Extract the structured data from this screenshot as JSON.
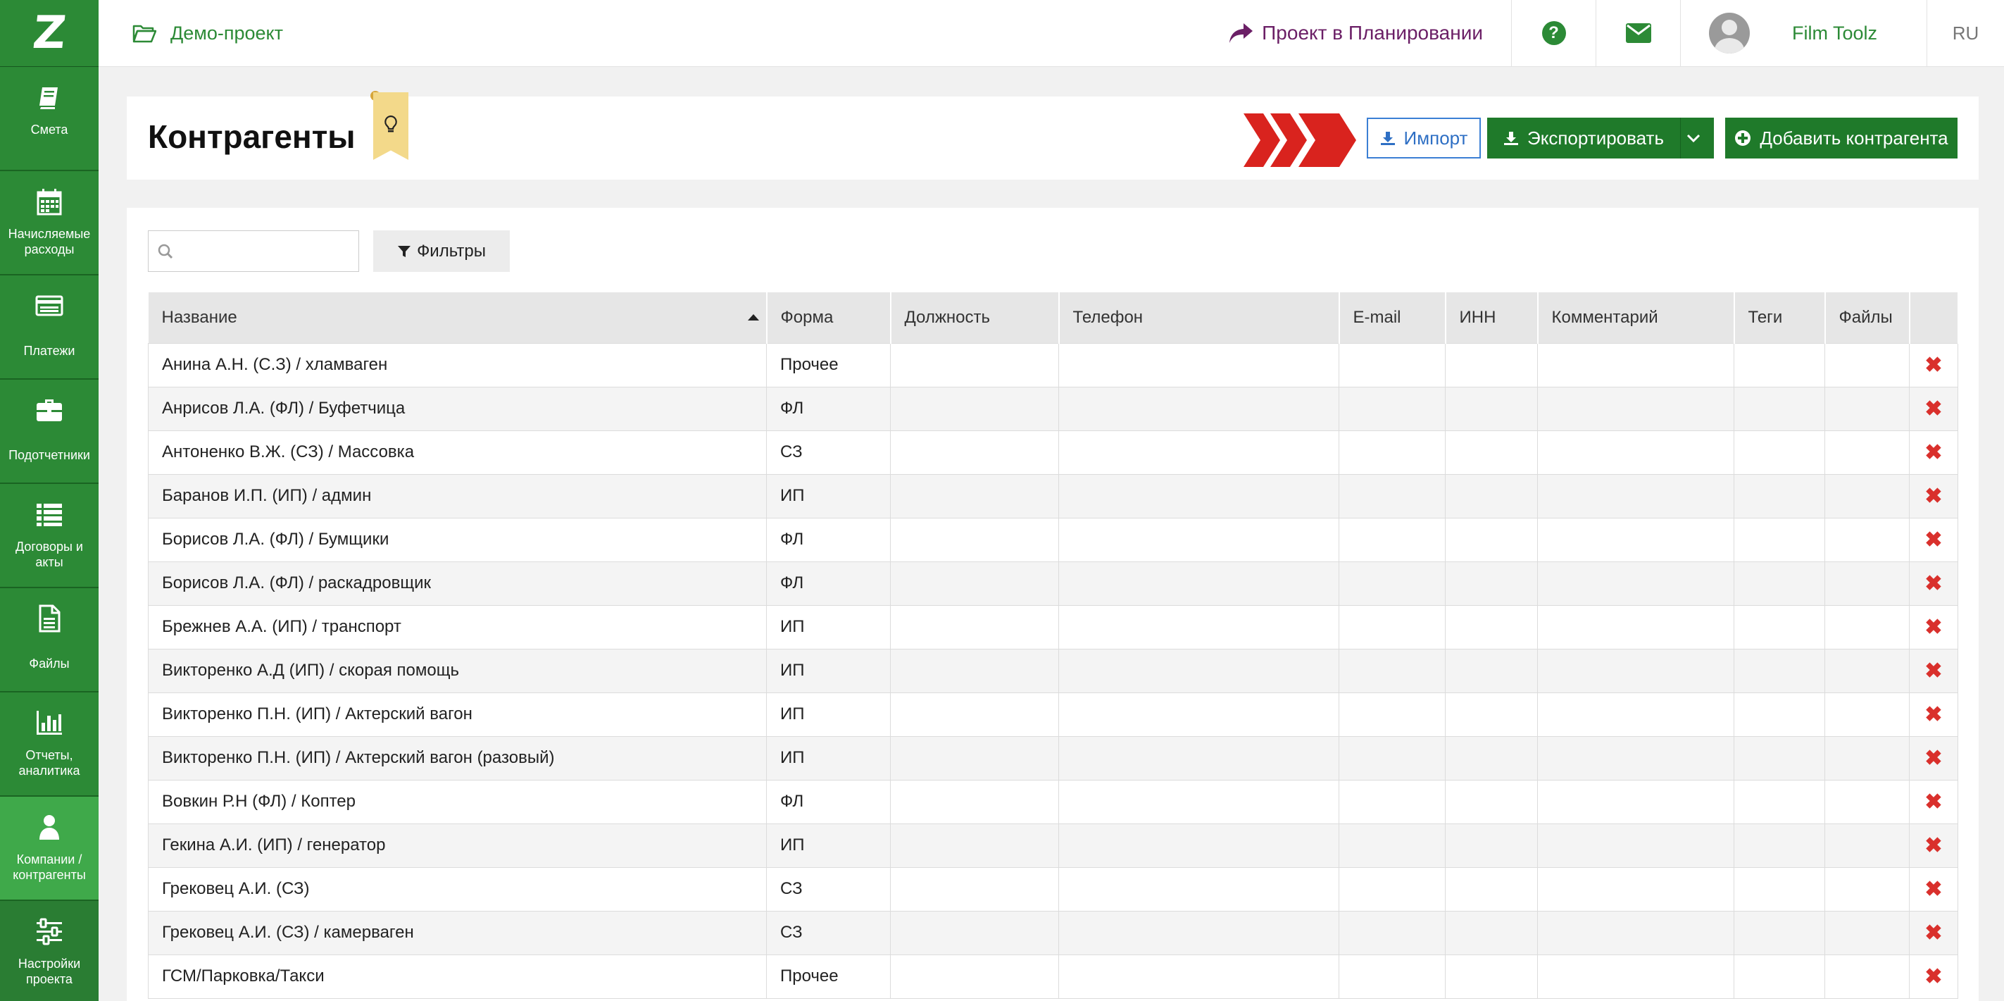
{
  "sidebar": {
    "logo": "Z",
    "items": [
      {
        "label": "Смета",
        "icon": "book-icon"
      },
      {
        "label": "Начисляемые расходы",
        "icon": "calendar-icon"
      },
      {
        "label": "Платежи",
        "icon": "card-icon"
      },
      {
        "label": "Подотчетники",
        "icon": "briefcase-icon"
      },
      {
        "label": "Договоры и акты",
        "icon": "list-icon"
      },
      {
        "label": "Файлы",
        "icon": "file-icon"
      },
      {
        "label": "Отчеты, аналитика",
        "icon": "bar-chart-icon"
      },
      {
        "label": "Компании / контрагенты",
        "icon": "user-icon"
      },
      {
        "label": "Настройки проекта",
        "icon": "sliders-icon"
      }
    ]
  },
  "topbar": {
    "project": "Демо-проект",
    "status": "Проект в Планировании",
    "user": "Film Toolz",
    "lang": "RU"
  },
  "header": {
    "title": "Контрагенты",
    "import_label": "Импорт",
    "export_label": "Экспортировать",
    "add_label": "Добавить контрагента"
  },
  "toolbar": {
    "search_placeholder": "",
    "filters_label": "Фильтры"
  },
  "table": {
    "columns": [
      "Название",
      "Форма",
      "Должность",
      "Телефон",
      "E-mail",
      "ИНН",
      "Комментарий",
      "Теги",
      "Файлы",
      ""
    ],
    "rows": [
      {
        "name": "Анина А.Н. (С.З) / хламваген",
        "form": "Прочее"
      },
      {
        "name": "Анрисов Л.А. (ФЛ) / Буфетчица",
        "form": "ФЛ"
      },
      {
        "name": "Антоненко В.Ж. (СЗ) / Массовка",
        "form": "СЗ"
      },
      {
        "name": "Баранов И.П. (ИП) / админ",
        "form": "ИП"
      },
      {
        "name": "Борисов Л.А. (ФЛ) / Бумщики",
        "form": "ФЛ"
      },
      {
        "name": "Борисов Л.А. (ФЛ) / раскадровщик",
        "form": "ФЛ"
      },
      {
        "name": "Брежнев А.А. (ИП) / транспорт",
        "form": "ИП"
      },
      {
        "name": "Викторенко А.Д (ИП) / скорая помощь",
        "form": "ИП"
      },
      {
        "name": "Викторенко П.Н. (ИП) / Актерский вагон",
        "form": "ИП"
      },
      {
        "name": "Викторенко П.Н. (ИП) / Актерский вагон (разовый)",
        "form": "ИП"
      },
      {
        "name": "Вовкин Р.Н (ФЛ) / Коптер",
        "form": "ФЛ"
      },
      {
        "name": "Гекина А.И. (ИП) / генератор",
        "form": "ИП"
      },
      {
        "name": "Грековец А.И. (СЗ)",
        "form": "СЗ"
      },
      {
        "name": "Грековец А.И. (СЗ) / камерваген",
        "form": "СЗ"
      },
      {
        "name": "ГСМ/Парковка/Такси",
        "form": "Прочее"
      }
    ]
  }
}
